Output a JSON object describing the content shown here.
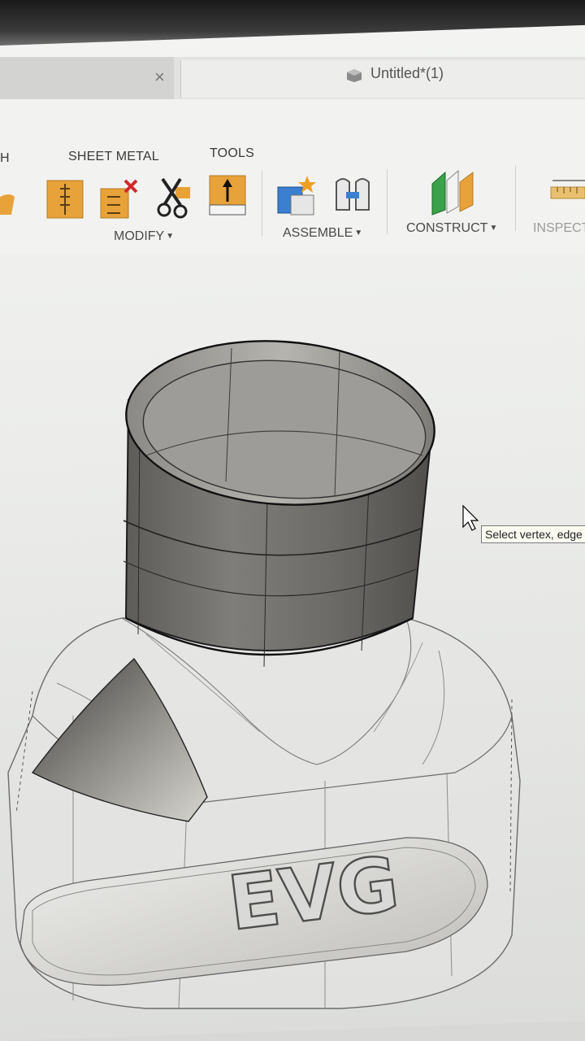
{
  "window": {
    "document_title": "Untitled*(1)"
  },
  "toolbar": {
    "tabs": [
      {
        "label": "H"
      },
      {
        "label": "SHEET METAL"
      },
      {
        "label": "TOOLS"
      }
    ],
    "groups": {
      "modify": "MODIFY",
      "assemble": "ASSEMBLE",
      "construct": "CONSTRUCT",
      "inspect": "INSPECT"
    }
  },
  "viewport": {
    "tooltip": "Select vertex, edge",
    "emboss_text": "EVG"
  },
  "colors": {
    "tool_orange": "#e8a23a",
    "tool_blue": "#3a7fd0",
    "tool_green": "#3aa24a",
    "body_gray": "#6f6e6b"
  }
}
